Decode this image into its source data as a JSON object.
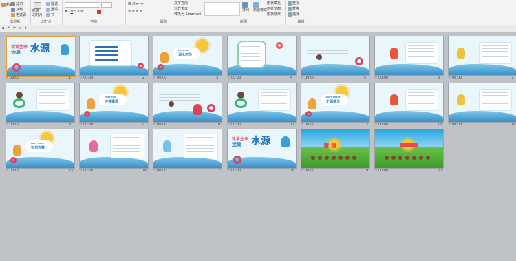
{
  "ribbon": {
    "clipboard": {
      "cut": "剪切",
      "copy": "复制",
      "paste": "粘贴",
      "format_painter": "格式刷",
      "title": "剪贴板"
    },
    "slides_group": {
      "new_slide": "新建\n幻灯片",
      "layout": "版式",
      "reset": "重设",
      "section": "节",
      "title": "幻灯片"
    },
    "font_group": {
      "title": "字体"
    },
    "paragraph_group": {
      "text_direction": "文字方向",
      "align_text": "对齐文本",
      "smartart": "转换为 SmartArt",
      "title": "段落"
    },
    "drawing_group": {
      "arrange": "排列",
      "quick_styles": "快速样式",
      "shape_fill": "形状填充",
      "shape_outline": "形状轮廓",
      "shape_effects": "形状效果",
      "title": "绘图"
    },
    "editing_group": {
      "find": "查找",
      "replace": "替换",
      "select": "选择",
      "title": "编辑"
    }
  },
  "slides": [
    {
      "n": "1",
      "time": "00:00",
      "kind": "title",
      "title_a": "珍爱生命",
      "title_b": "远离",
      "title_c": "水源"
    },
    {
      "n": "2",
      "time": "00:00",
      "kind": "toc"
    },
    {
      "n": "3",
      "time": "00:00",
      "kind": "part",
      "label": "PART ONE",
      "caption": "溺水危险"
    },
    {
      "n": "4",
      "time": "00:00",
      "kind": "frame"
    },
    {
      "n": "5",
      "time": "00:00",
      "kind": "text"
    },
    {
      "n": "6",
      "time": "00:00",
      "kind": "textkid"
    },
    {
      "n": "7",
      "time": "00:00",
      "kind": "textkid2"
    },
    {
      "n": "8",
      "time": "00:00",
      "kind": "girltext"
    },
    {
      "n": "9",
      "time": "00:00",
      "kind": "part",
      "label": "PART TWO",
      "caption": "注意事项"
    },
    {
      "n": "10",
      "time": "00:00",
      "kind": "pooltext"
    },
    {
      "n": "11",
      "time": "00:00",
      "kind": "girltext"
    },
    {
      "n": "12",
      "time": "00:00",
      "kind": "part",
      "label": "PART THREE",
      "caption": "正确做法"
    },
    {
      "n": "13",
      "time": "00:00",
      "kind": "textkid"
    },
    {
      "n": "14",
      "time": "00:00",
      "kind": "textkid2"
    },
    {
      "n": "15",
      "time": "00:00",
      "kind": "part",
      "label": "PART FOUR",
      "caption": "如何自救"
    },
    {
      "n": "16",
      "time": "00:00",
      "kind": "sidekid"
    },
    {
      "n": "17",
      "time": "00:00",
      "kind": "sidekid2"
    },
    {
      "n": "18",
      "time": "00:00",
      "kind": "title",
      "title_a": "珍爱生命",
      "title_b": "远离",
      "title_c": "水源"
    },
    {
      "n": "19",
      "time": "00:00",
      "kind": "thanks",
      "caption": "谢 谢"
    },
    {
      "n": "20",
      "time": "00:00",
      "kind": "thanks2"
    }
  ]
}
